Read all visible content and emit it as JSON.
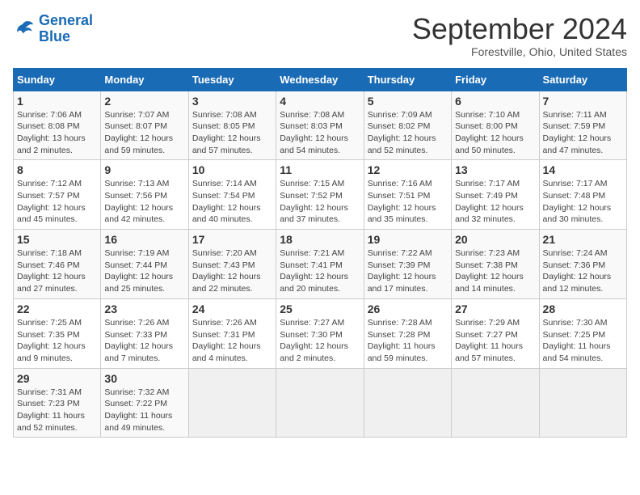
{
  "header": {
    "logo_line1": "General",
    "logo_line2": "Blue",
    "title": "September 2024",
    "subtitle": "Forestville, Ohio, United States"
  },
  "calendar": {
    "days_of_week": [
      "Sunday",
      "Monday",
      "Tuesday",
      "Wednesday",
      "Thursday",
      "Friday",
      "Saturday"
    ],
    "weeks": [
      [
        {
          "day": "1",
          "info": "Sunrise: 7:06 AM\nSunset: 8:08 PM\nDaylight: 13 hours\nand 2 minutes."
        },
        {
          "day": "2",
          "info": "Sunrise: 7:07 AM\nSunset: 8:07 PM\nDaylight: 12 hours\nand 59 minutes."
        },
        {
          "day": "3",
          "info": "Sunrise: 7:08 AM\nSunset: 8:05 PM\nDaylight: 12 hours\nand 57 minutes."
        },
        {
          "day": "4",
          "info": "Sunrise: 7:08 AM\nSunset: 8:03 PM\nDaylight: 12 hours\nand 54 minutes."
        },
        {
          "day": "5",
          "info": "Sunrise: 7:09 AM\nSunset: 8:02 PM\nDaylight: 12 hours\nand 52 minutes."
        },
        {
          "day": "6",
          "info": "Sunrise: 7:10 AM\nSunset: 8:00 PM\nDaylight: 12 hours\nand 50 minutes."
        },
        {
          "day": "7",
          "info": "Sunrise: 7:11 AM\nSunset: 7:59 PM\nDaylight: 12 hours\nand 47 minutes."
        }
      ],
      [
        {
          "day": "8",
          "info": "Sunrise: 7:12 AM\nSunset: 7:57 PM\nDaylight: 12 hours\nand 45 minutes."
        },
        {
          "day": "9",
          "info": "Sunrise: 7:13 AM\nSunset: 7:56 PM\nDaylight: 12 hours\nand 42 minutes."
        },
        {
          "day": "10",
          "info": "Sunrise: 7:14 AM\nSunset: 7:54 PM\nDaylight: 12 hours\nand 40 minutes."
        },
        {
          "day": "11",
          "info": "Sunrise: 7:15 AM\nSunset: 7:52 PM\nDaylight: 12 hours\nand 37 minutes."
        },
        {
          "day": "12",
          "info": "Sunrise: 7:16 AM\nSunset: 7:51 PM\nDaylight: 12 hours\nand 35 minutes."
        },
        {
          "day": "13",
          "info": "Sunrise: 7:17 AM\nSunset: 7:49 PM\nDaylight: 12 hours\nand 32 minutes."
        },
        {
          "day": "14",
          "info": "Sunrise: 7:17 AM\nSunset: 7:48 PM\nDaylight: 12 hours\nand 30 minutes."
        }
      ],
      [
        {
          "day": "15",
          "info": "Sunrise: 7:18 AM\nSunset: 7:46 PM\nDaylight: 12 hours\nand 27 minutes."
        },
        {
          "day": "16",
          "info": "Sunrise: 7:19 AM\nSunset: 7:44 PM\nDaylight: 12 hours\nand 25 minutes."
        },
        {
          "day": "17",
          "info": "Sunrise: 7:20 AM\nSunset: 7:43 PM\nDaylight: 12 hours\nand 22 minutes."
        },
        {
          "day": "18",
          "info": "Sunrise: 7:21 AM\nSunset: 7:41 PM\nDaylight: 12 hours\nand 20 minutes."
        },
        {
          "day": "19",
          "info": "Sunrise: 7:22 AM\nSunset: 7:39 PM\nDaylight: 12 hours\nand 17 minutes."
        },
        {
          "day": "20",
          "info": "Sunrise: 7:23 AM\nSunset: 7:38 PM\nDaylight: 12 hours\nand 14 minutes."
        },
        {
          "day": "21",
          "info": "Sunrise: 7:24 AM\nSunset: 7:36 PM\nDaylight: 12 hours\nand 12 minutes."
        }
      ],
      [
        {
          "day": "22",
          "info": "Sunrise: 7:25 AM\nSunset: 7:35 PM\nDaylight: 12 hours\nand 9 minutes."
        },
        {
          "day": "23",
          "info": "Sunrise: 7:26 AM\nSunset: 7:33 PM\nDaylight: 12 hours\nand 7 minutes."
        },
        {
          "day": "24",
          "info": "Sunrise: 7:26 AM\nSunset: 7:31 PM\nDaylight: 12 hours\nand 4 minutes."
        },
        {
          "day": "25",
          "info": "Sunrise: 7:27 AM\nSunset: 7:30 PM\nDaylight: 12 hours\nand 2 minutes."
        },
        {
          "day": "26",
          "info": "Sunrise: 7:28 AM\nSunset: 7:28 PM\nDaylight: 11 hours\nand 59 minutes."
        },
        {
          "day": "27",
          "info": "Sunrise: 7:29 AM\nSunset: 7:27 PM\nDaylight: 11 hours\nand 57 minutes."
        },
        {
          "day": "28",
          "info": "Sunrise: 7:30 AM\nSunset: 7:25 PM\nDaylight: 11 hours\nand 54 minutes."
        }
      ],
      [
        {
          "day": "29",
          "info": "Sunrise: 7:31 AM\nSunset: 7:23 PM\nDaylight: 11 hours\nand 52 minutes."
        },
        {
          "day": "30",
          "info": "Sunrise: 7:32 AM\nSunset: 7:22 PM\nDaylight: 11 hours\nand 49 minutes."
        },
        {
          "day": "",
          "info": ""
        },
        {
          "day": "",
          "info": ""
        },
        {
          "day": "",
          "info": ""
        },
        {
          "day": "",
          "info": ""
        },
        {
          "day": "",
          "info": ""
        }
      ]
    ]
  }
}
